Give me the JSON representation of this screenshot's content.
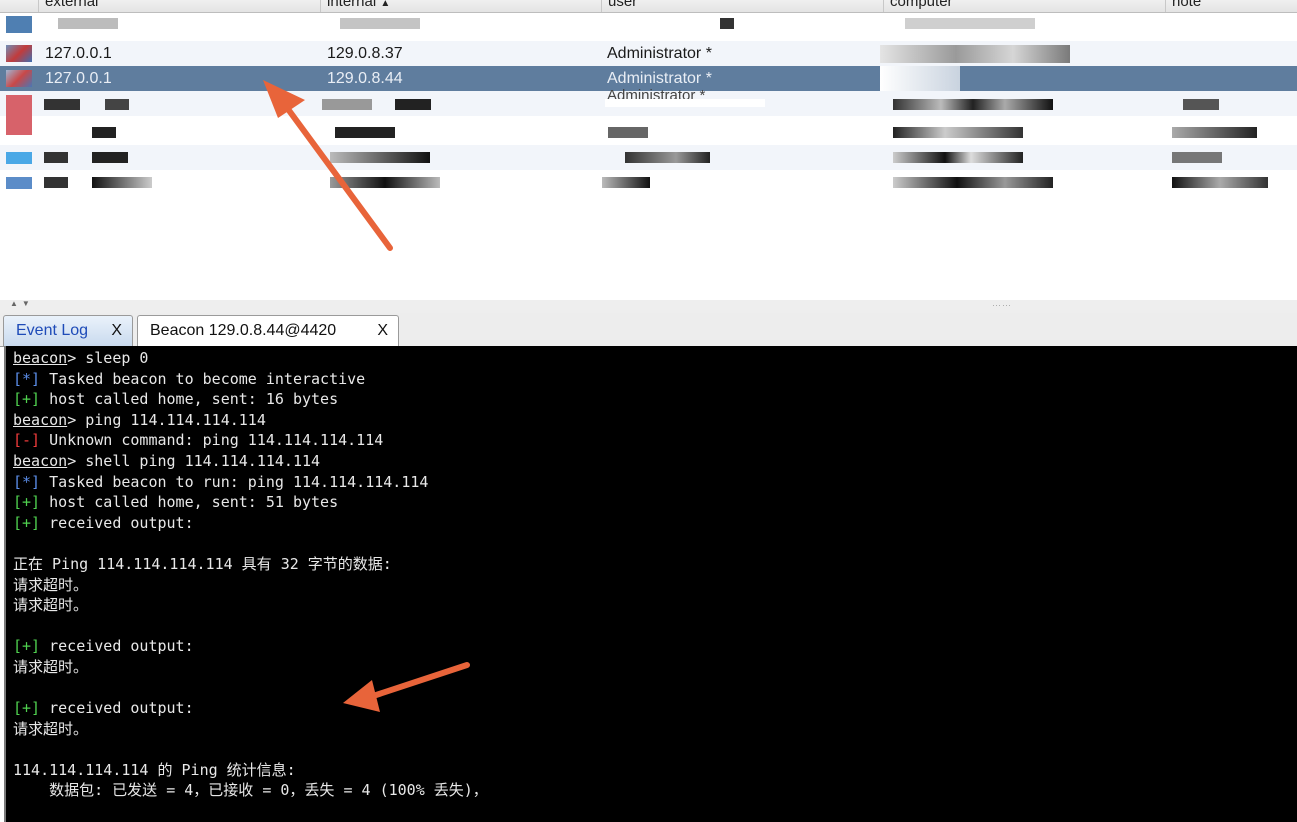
{
  "table": {
    "columns": [
      {
        "label": "external",
        "sort_indicator": ""
      },
      {
        "label": "internal",
        "sort_indicator": "▲"
      },
      {
        "label": "user",
        "sort_indicator": ""
      },
      {
        "label": "computer",
        "sort_indicator": ""
      },
      {
        "label": "note",
        "sort_indicator": ""
      }
    ],
    "rows": [
      {
        "external": "",
        "internal": "",
        "user": "",
        "computer": "",
        "note": ""
      },
      {
        "external": "127.0.0.1",
        "internal": "129.0.8.37",
        "user": "Administrator *",
        "computer": "",
        "note": ""
      },
      {
        "external": "127.0.0.1",
        "internal": "129.0.8.44",
        "user": "Administrator *",
        "computer": "",
        "note": "",
        "selected": true
      },
      {
        "external": "",
        "internal": "",
        "user": "Administrator *",
        "computer": "",
        "note": ""
      },
      {
        "external": "",
        "internal": "",
        "user": "",
        "computer": "",
        "note": ""
      },
      {
        "external": "",
        "internal": "",
        "user": "",
        "computer": "",
        "note": ""
      },
      {
        "external": "",
        "internal": "",
        "user": "",
        "computer": "",
        "note": ""
      }
    ]
  },
  "tabs": [
    {
      "label": "Event Log",
      "close": "X"
    },
    {
      "label": "Beacon 129.0.8.44@4420",
      "close": "X"
    }
  ],
  "console": {
    "lines": [
      {
        "prompt": "beacon",
        "text": "> sleep 0"
      },
      {
        "tag": "[*]",
        "kind": "info",
        "text": " Tasked beacon to become interactive"
      },
      {
        "tag": "[+]",
        "kind": "ok",
        "text": " host called home, sent: 16 bytes"
      },
      {
        "prompt": "beacon",
        "text": "> ping 114.114.114.114"
      },
      {
        "tag": "[-]",
        "kind": "err",
        "text": " Unknown command: ping 114.114.114.114"
      },
      {
        "prompt": "beacon",
        "text": "> shell ping 114.114.114.114"
      },
      {
        "tag": "[*]",
        "kind": "info",
        "text": " Tasked beacon to run: ping 114.114.114.114"
      },
      {
        "tag": "[+]",
        "kind": "ok",
        "text": " host called home, sent: 51 bytes"
      },
      {
        "tag": "[+]",
        "kind": "ok",
        "text": " received output:"
      },
      {
        "text": ""
      },
      {
        "text": "正在 Ping 114.114.114.114 具有 32 字节的数据:"
      },
      {
        "text": "请求超时。"
      },
      {
        "text": "请求超时。"
      },
      {
        "text": ""
      },
      {
        "tag": "[+]",
        "kind": "ok",
        "text": " received output:"
      },
      {
        "text": "请求超时。"
      },
      {
        "text": ""
      },
      {
        "tag": "[+]",
        "kind": "ok",
        "text": " received output:"
      },
      {
        "text": "请求超时。"
      },
      {
        "text": ""
      },
      {
        "text": "114.114.114.114 的 Ping 统计信息:"
      },
      {
        "text": "    数据包: 已发送 = 4，已接收 = 0，丢失 = 4 (100% 丢失)，"
      }
    ]
  },
  "colors": {
    "selected_row": "#5f7d9e",
    "console_bg": "#000000",
    "tag_info": "#5b8de8",
    "tag_ok": "#4fd14f",
    "tag_err": "#f03c3c",
    "annotation_arrow": "#e8643a",
    "event_tab_text": "#1e4bb8"
  }
}
